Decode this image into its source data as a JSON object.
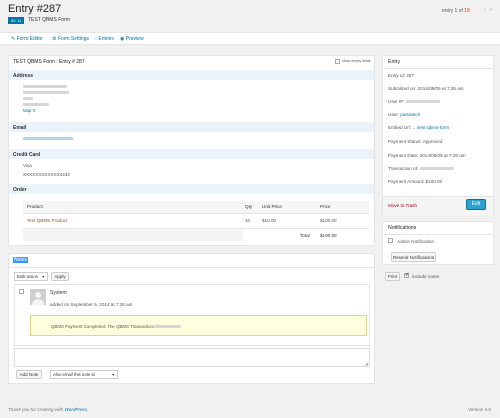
{
  "header": {
    "title": "Entry #287",
    "form_id_badge": "ID: 11",
    "form_name": "TEST QBMS Form",
    "pager_prefix": "entry",
    "pager_current": "1",
    "pager_of": "of",
    "pager_total": "18"
  },
  "toolbar": {
    "form_editor": "Form Editor",
    "form_settings": "Form Settings",
    "entries": "Entries",
    "preview": "Preview"
  },
  "main": {
    "panel_title": "TEST QBMS Form : Entry # 287",
    "show_empty_fields": "show empty fields",
    "address_label": "Address",
    "address_map_link": "Map It",
    "email_label": "Email",
    "credit_card_label": "Credit Card",
    "card_type": "Visa",
    "card_number": "XXXXXXXXXXXX4242",
    "order_label": "Order",
    "order_table": {
      "headers": [
        "Product",
        "Qty",
        "Unit Price",
        "Price"
      ],
      "rows": [
        [
          "Test QBMS Product",
          "10",
          "$10.00",
          "$100.00"
        ]
      ],
      "total_label": "Total",
      "total_value": "$100.00"
    }
  },
  "notes": {
    "title": "Notes",
    "bulk_action": "Bulk action",
    "apply": "Apply",
    "author": "System",
    "added_on": "added on September 9, 2014 at 7:26 am",
    "message_prefix": "QBMS Payment Completed. The QBMS Transaction Id:",
    "add_note": "Add Note",
    "also_email": "Also email this note to"
  },
  "sidebar": {
    "entry_title": "Entry",
    "entry_id": "Entry Id: 287",
    "submitted_on": "Submitted on: 2014/09/09 at 7:26 am",
    "user_ip_label": "User IP:",
    "user_label": "User:",
    "user_value": "patsatech",
    "embed_label": "Embed Url:",
    "embed_value": "…/test-qbms-form",
    "payment_status": "Payment Status: Approved",
    "payment_date": "Payment Date: 2014/09/09 at 7:26 am",
    "transaction_label": "Transaction Id:",
    "payment_amount": "Payment Amount: $100.00",
    "move_to_trash": "Move to Trash",
    "edit": "Edit",
    "notifications_title": "Notifications",
    "admin_notification": "Admin Notification",
    "resend_notifications": "Resend Notifications",
    "print": "Print",
    "include_notes": "include notes"
  },
  "footer": {
    "thanks_prefix": "Thank you for creating with",
    "wordpress": "WordPress",
    "version": "Version 4.0"
  },
  "colors": {
    "accent": "#0074a2",
    "primary_button": "#2ea2cc",
    "trash": "#a00",
    "section_header": "#eaf2fa",
    "note_highlight": "#ffffe0"
  }
}
